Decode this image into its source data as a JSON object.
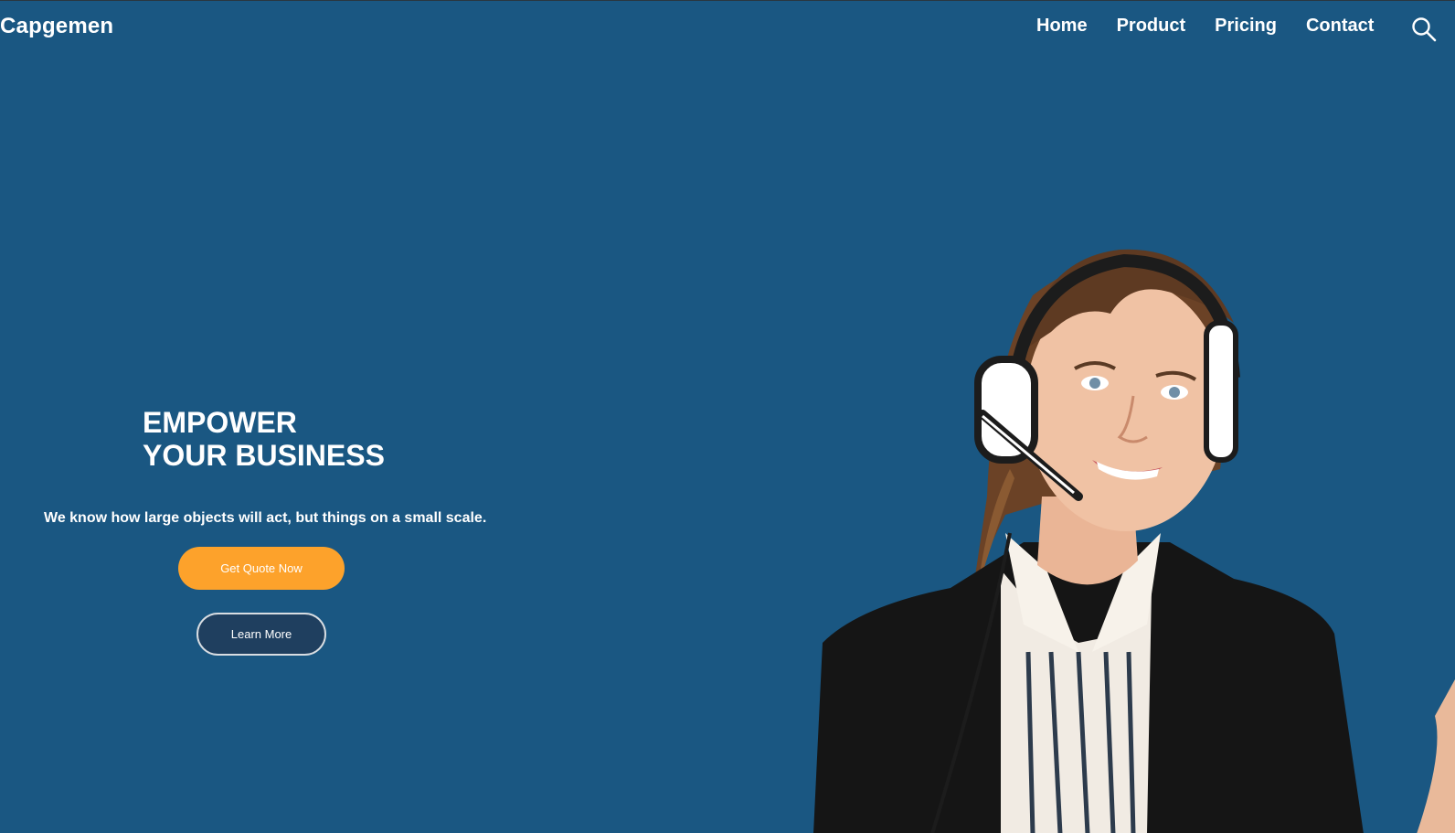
{
  "brand": {
    "name": "Capgemen"
  },
  "nav": {
    "items": [
      {
        "label": "Home"
      },
      {
        "label": "Product"
      },
      {
        "label": "Pricing"
      },
      {
        "label": "Contact"
      }
    ],
    "search_icon": "search-icon"
  },
  "hero": {
    "title_line1": "EMPOWER",
    "title_line2": "YOUR BUSINESS",
    "subtitle": "We know how large objects will act, but things on a small scale.",
    "primary_button": "Get Quote Now",
    "secondary_button": "Learn More",
    "image": "support-agent-with-headset"
  },
  "colors": {
    "background": "#1a5782",
    "accent": "#fda22b",
    "text": "#ffffff",
    "secondary_button_bg": "#1f3f5f"
  }
}
